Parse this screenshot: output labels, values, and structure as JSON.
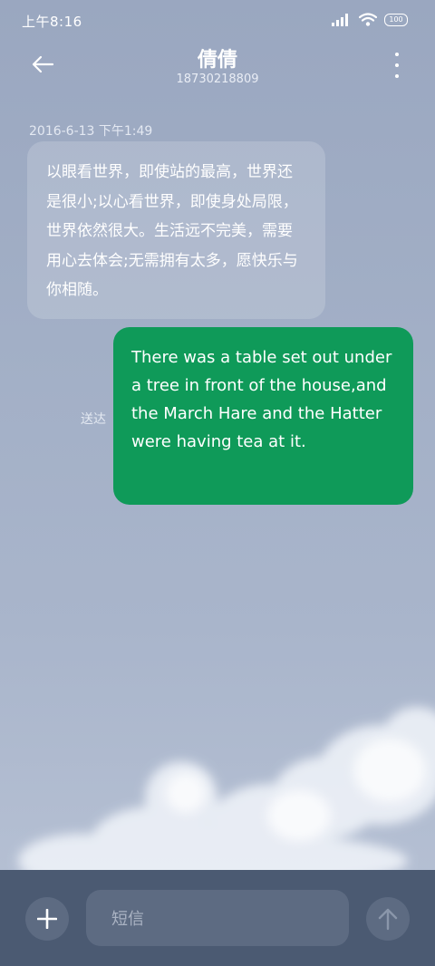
{
  "status_bar": {
    "time": "上午8:16",
    "battery": "100"
  },
  "header": {
    "contact_name": "倩倩",
    "contact_number": "18730218809"
  },
  "conversation": {
    "timestamp": "2016-6-13 下午1:49",
    "received_message": "以眼看世界，即使站的最高，世界还是很小;以心看世界，即使身处局限，世界依然很大。生活远不完美，需要用心去体会;无需拥有太多，愿快乐与你相随。",
    "sent_message": "There was a table set out under a tree in front of the house,and the March Hare and the Hatter were having tea at it.",
    "sent_status": "送达"
  },
  "composer": {
    "placeholder": "短信"
  },
  "colors": {
    "sent_bubble": "#0f9a59",
    "bottom_bar": "#4b5a72"
  }
}
